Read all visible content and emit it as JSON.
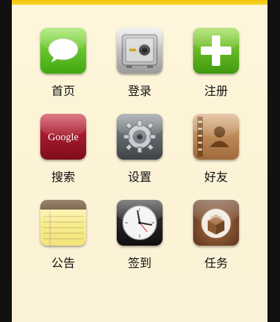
{
  "grid": {
    "items": [
      {
        "label": "首页",
        "icon": "speech-bubble-icon"
      },
      {
        "label": "登录",
        "icon": "safe-icon"
      },
      {
        "label": "注册",
        "icon": "plus-icon"
      },
      {
        "label": "搜索",
        "icon": "google-icon",
        "icon_text": "Google"
      },
      {
        "label": "设置",
        "icon": "gears-icon"
      },
      {
        "label": "好友",
        "icon": "contacts-book-icon"
      },
      {
        "label": "公告",
        "icon": "notepad-icon"
      },
      {
        "label": "签到",
        "icon": "clock-icon"
      },
      {
        "label": "任务",
        "icon": "cydia-box-icon"
      }
    ]
  },
  "colors": {
    "accent_bar": "#f4c400",
    "background": "#fdf3d6"
  }
}
